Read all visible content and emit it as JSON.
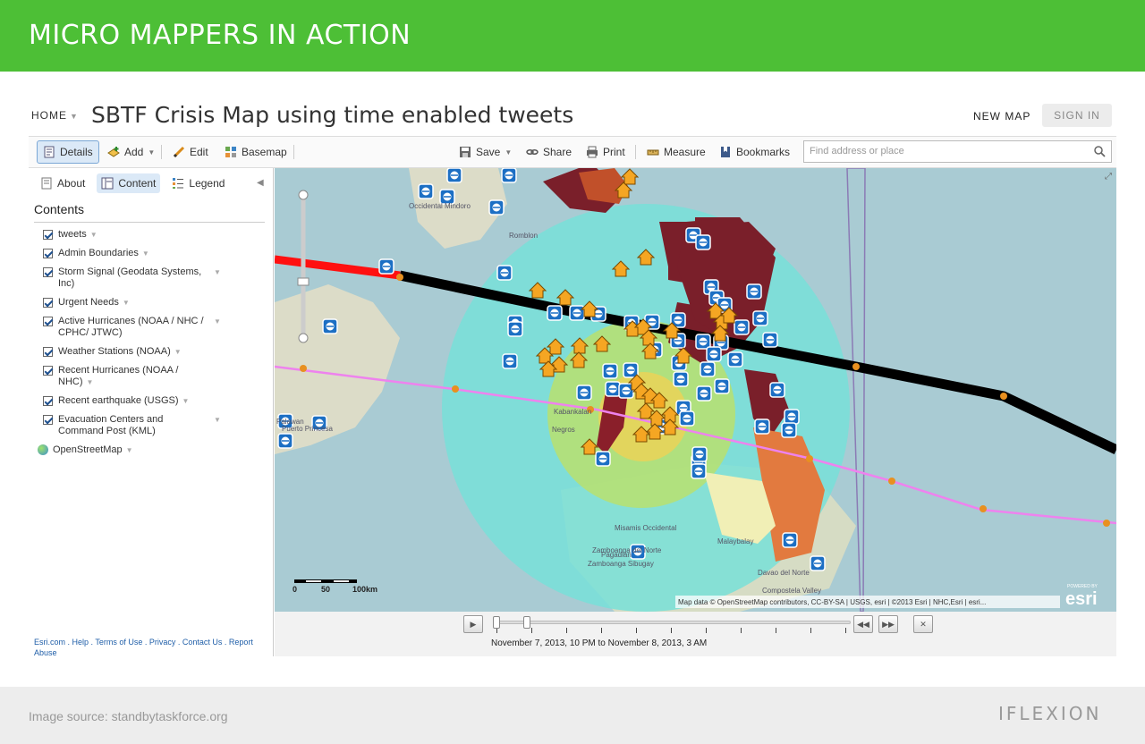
{
  "banner": {
    "title": "MICRO MAPPERS IN ACTION"
  },
  "topbar": {
    "home": "HOME",
    "title": "SBTF Crisis Map using time enabled tweets",
    "new_map": "NEW MAP",
    "sign_in": "SIGN IN"
  },
  "toolbar": {
    "details": "Details",
    "add": "Add",
    "edit": "Edit",
    "basemap": "Basemap",
    "save": "Save",
    "share": "Share",
    "print": "Print",
    "measure": "Measure",
    "bookmarks": "Bookmarks",
    "search_placeholder": "Find address or place"
  },
  "sidebar": {
    "tabs": [
      "About",
      "Content",
      "Legend"
    ],
    "heading": "Contents",
    "layers": [
      "tweets",
      "Admin Boundaries",
      "Storm Signal (Geodata Systems, Inc)",
      "Urgent Needs",
      "Active Hurricanes (NOAA / NHC / CPHC/ JTWC)",
      "Weather Stations (NOAA)",
      "Recent Hurricanes (NOAA / NHC)",
      "Recent earthquake (USGS)",
      "Evacuation Centers and Command Post (KML)"
    ],
    "basemap_layer": "OpenStreetMap",
    "footer": "Esri.com . Help . Terms of Use . Privacy . Contact Us . Report Abuse"
  },
  "map": {
    "scale_labels": [
      "0",
      "50",
      "100km"
    ],
    "attribution": "Map data © OpenStreetMap contributors, CC-BY-SA | USGS, esri | ©2013 Esri | NHC,Esri | esri...",
    "powered_by": "POWERED BY",
    "esri": "esri",
    "place_labels": [
      "Occidental Mindoro",
      "Romblon",
      "Negros",
      "Kabankalan",
      "Misamis Occidental",
      "Zamboanga del Norte",
      "Zamboanga Sibugay",
      "Pagadian",
      "Davao del Norte",
      "Compostela Valley",
      "Palawan",
      "Puerto Princesa",
      "Malaybalay"
    ]
  },
  "timeslider": {
    "label": "November 7, 2013, 10 PM to November 8, 2013, 3 AM"
  },
  "footer": {
    "source": "Image source: standbytaskforce.org",
    "logo": "IFLEXION"
  },
  "colors": {
    "banner": "#4dbf36",
    "storm_track": "#000000",
    "forecast_track": "#ee82ee",
    "pin_blue": "#1c6fc4",
    "pin_orange": "#f5a623",
    "admin_dark_red": "#7a1f2a"
  }
}
